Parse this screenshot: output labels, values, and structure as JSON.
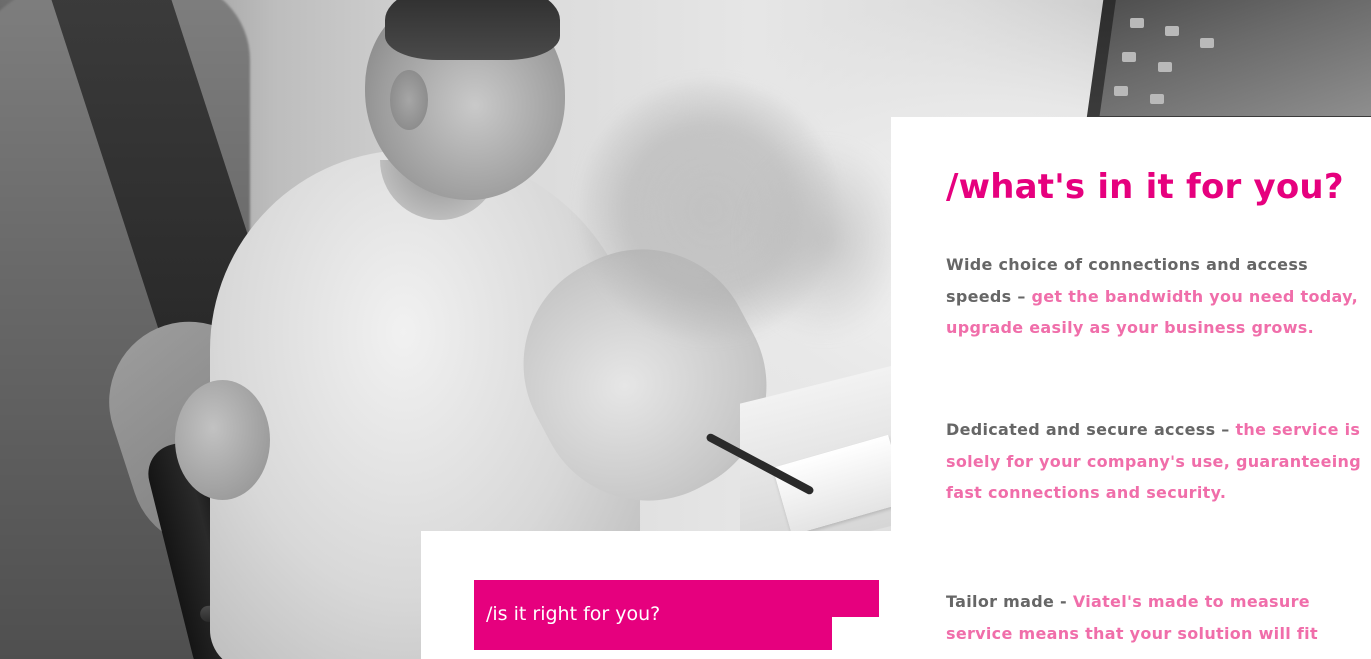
{
  "hero": {
    "description_icon": "photo-grayscale"
  },
  "info": {
    "title": "/what's in it for you?",
    "benefits": [
      {
        "head": "Wide choice of connections and access speeds – ",
        "body": "get the bandwidth you need today, upgrade easily as your business grows."
      },
      {
        "head": "Dedicated and secure access – ",
        "body": "the service is solely for your company's use, guaranteeing fast connections and security."
      },
      {
        "head": "Tailor made - ",
        "body": "Viatel's made to measure service means that your solution will fit"
      }
    ]
  },
  "right_section": {
    "label": "/is it right for you?"
  },
  "colors": {
    "brand_magenta": "#e6007e",
    "body_pink": "#f06eaa",
    "heading_gray": "#666666"
  }
}
